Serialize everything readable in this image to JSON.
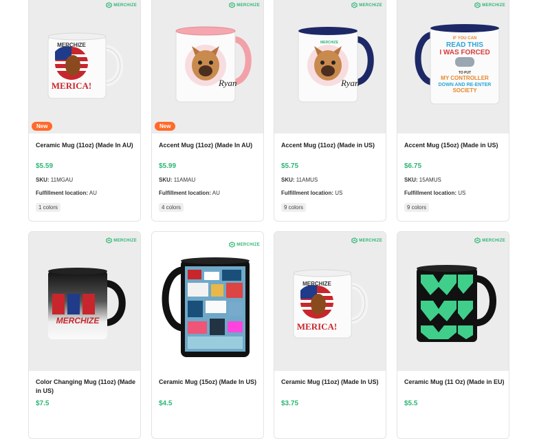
{
  "brand_name": "MERCHIZE",
  "colors": {
    "accent": "#2bb673",
    "badge": "#ff6a2a"
  },
  "products": [
    {
      "title": "Ceramic Mug (11oz) (Made In AU)",
      "price": "$5.59",
      "sku_label": "SKU:",
      "sku": "11MGAU",
      "fulfillment_label": "Fulfillment location:",
      "fulfillment": "AU",
      "colors_label": "1 colors",
      "badge": "New",
      "image_icon": "mug-usa-merica-image"
    },
    {
      "title": "Accent Mug (11oz) (Made In AU)",
      "price": "$5.99",
      "sku_label": "SKU:",
      "sku": "11AMAU",
      "fulfillment_label": "Fulfillment location:",
      "fulfillment": "AU",
      "colors_label": "4 colors",
      "badge": "New",
      "image_icon": "mug-pink-bulldog-image"
    },
    {
      "title": "Accent Mug (11oz) (Made in US)",
      "price": "$5.75",
      "sku_label": "SKU:",
      "sku": "11AMUS",
      "fulfillment_label": "Fulfillment location:",
      "fulfillment": "US",
      "colors_label": "9 colors",
      "image_icon": "mug-navy-bulldog-image"
    },
    {
      "title": "Accent Mug (15oz) (Made in US)",
      "price": "$6.75",
      "sku_label": "SKU:",
      "sku": "15AMUS",
      "fulfillment_label": "Fulfillment location:",
      "fulfillment": "US",
      "colors_label": "9 colors",
      "image_icon": "mug-gamer-quote-image"
    },
    {
      "title": "Color Changing Mug (11oz) (Made in US)",
      "price": "$7.5",
      "image_icon": "mug-color-changing-image"
    },
    {
      "title": "Ceramic Mug (15oz) (Made In US)",
      "price": "$4.5",
      "image_icon": "mug-black-stickers-image"
    },
    {
      "title": "Ceramic Mug (11oz) (Made In US)",
      "price": "$3.75",
      "image_icon": "mug-usa-merica-image"
    },
    {
      "title": "Ceramic Mug (11 Oz) (Made in EU)",
      "price": "$5.5",
      "image_icon": "mug-green-pattern-image"
    }
  ],
  "mug_text": {
    "merchize": "MERCHIZE",
    "merica": "MERICA!",
    "gamer": [
      "IF YOU CAN",
      "READ THIS",
      "I WAS FORCED",
      "TO PUT",
      "MY CONTROLLER",
      "DOWN AND RE-ENTER",
      "SOCIETY"
    ],
    "dog_name": "Ryan"
  }
}
